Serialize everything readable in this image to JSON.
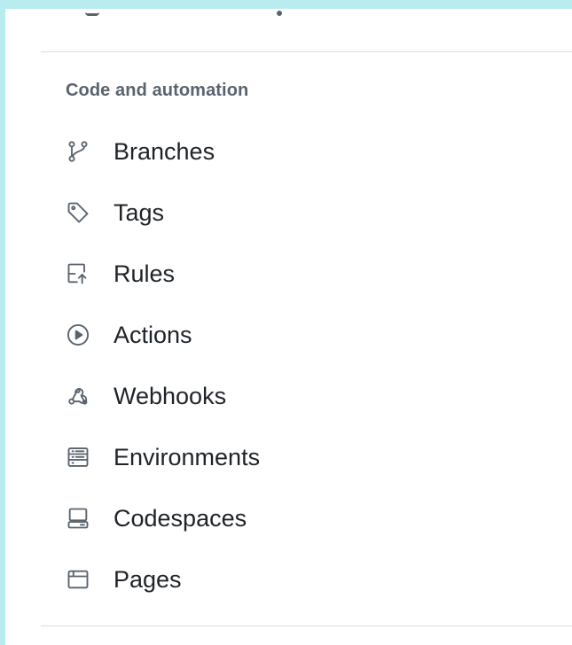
{
  "section": {
    "heading": "Code and automation"
  },
  "nav_items": [
    {
      "label": "Branches",
      "icon": "git-branch-icon"
    },
    {
      "label": "Tags",
      "icon": "tag-icon"
    },
    {
      "label": "Rules",
      "icon": "rules-icon"
    },
    {
      "label": "Actions",
      "icon": "play-icon"
    },
    {
      "label": "Webhooks",
      "icon": "webhook-icon"
    },
    {
      "label": "Environments",
      "icon": "server-icon"
    },
    {
      "label": "Codespaces",
      "icon": "codespaces-icon"
    },
    {
      "label": "Pages",
      "icon": "browser-icon"
    }
  ],
  "colors": {
    "background": "#b9ecef",
    "panel": "#ffffff",
    "text_primary": "#1f2328",
    "text_muted": "#59636e",
    "divider": "#d8dee4"
  }
}
